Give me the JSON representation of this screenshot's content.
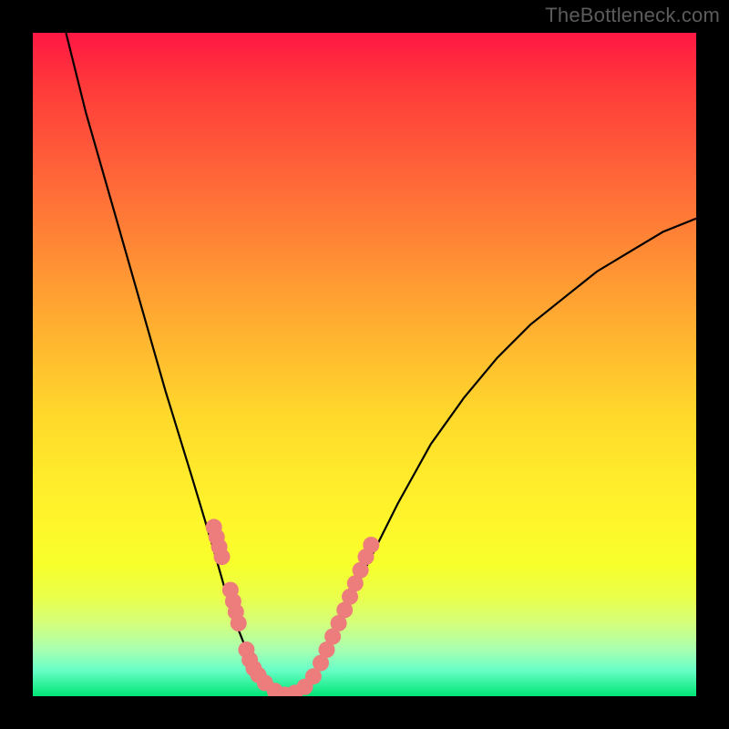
{
  "watermark": "TheBottleneck.com",
  "colors": {
    "frame": "#000000",
    "curve": "#000000",
    "marker": "#ed7c7c",
    "gradient_top": "#ff1744",
    "gradient_bottom": "#00e676"
  },
  "chart_data": {
    "type": "line",
    "title": "",
    "xlabel": "",
    "ylabel": "",
    "xlim": [
      0,
      100
    ],
    "ylim": [
      0,
      100
    ],
    "series": [
      {
        "name": "bottleneck-curve",
        "x": [
          5,
          8,
          12,
          16,
          20,
          24,
          27,
          29,
          31,
          33,
          35,
          37,
          39,
          41,
          43,
          46,
          50,
          55,
          60,
          65,
          70,
          75,
          80,
          85,
          90,
          95,
          100
        ],
        "y": [
          100,
          88,
          74,
          60,
          46,
          33,
          23,
          16,
          10,
          5,
          2,
          0,
          0,
          1,
          4,
          10,
          19,
          29,
          38,
          45,
          51,
          56,
          60,
          64,
          67,
          70,
          72
        ]
      }
    ],
    "markers": {
      "name": "salmon-dots",
      "color": "#ed7c7c",
      "points": [
        {
          "x": 27.3,
          "y": 25.5
        },
        {
          "x": 27.7,
          "y": 24.0
        },
        {
          "x": 28.1,
          "y": 22.5
        },
        {
          "x": 28.5,
          "y": 21.0
        },
        {
          "x": 29.8,
          "y": 16.0
        },
        {
          "x": 30.2,
          "y": 14.3
        },
        {
          "x": 30.6,
          "y": 12.7
        },
        {
          "x": 31.0,
          "y": 11.0
        },
        {
          "x": 32.2,
          "y": 7.0
        },
        {
          "x": 32.7,
          "y": 5.5
        },
        {
          "x": 33.3,
          "y": 4.2
        },
        {
          "x": 34.0,
          "y": 3.2
        },
        {
          "x": 35.0,
          "y": 2.0
        },
        {
          "x": 36.5,
          "y": 0.8
        },
        {
          "x": 38.0,
          "y": 0.2
        },
        {
          "x": 39.5,
          "y": 0.5
        },
        {
          "x": 41.0,
          "y": 1.4
        },
        {
          "x": 42.3,
          "y": 3.0
        },
        {
          "x": 43.4,
          "y": 5.0
        },
        {
          "x": 44.3,
          "y": 7.0
        },
        {
          "x": 45.2,
          "y": 9.0
        },
        {
          "x": 46.1,
          "y": 11.0
        },
        {
          "x": 47.0,
          "y": 13.0
        },
        {
          "x": 47.8,
          "y": 15.0
        },
        {
          "x": 48.6,
          "y": 17.0
        },
        {
          "x": 49.4,
          "y": 19.0
        },
        {
          "x": 50.2,
          "y": 21.0
        },
        {
          "x": 51.0,
          "y": 22.8
        }
      ]
    }
  }
}
